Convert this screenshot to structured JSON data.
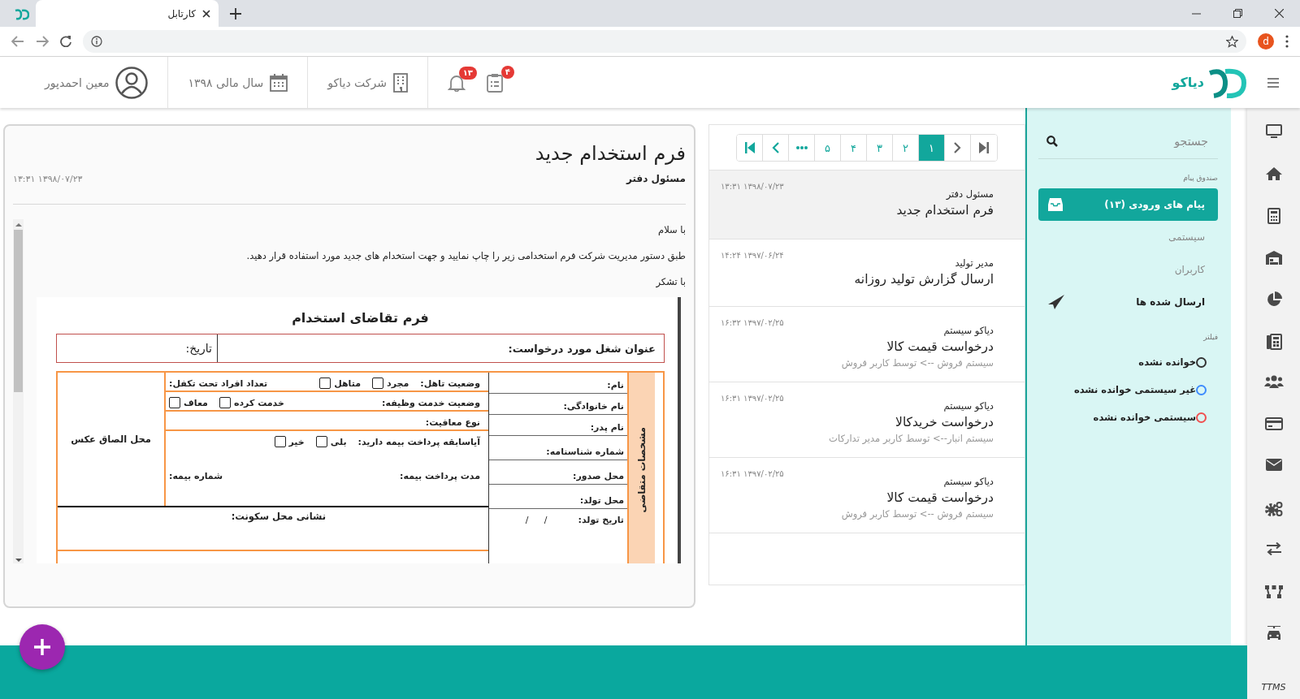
{
  "browser": {
    "tab_title": "کارتابل",
    "profile": "d"
  },
  "header": {
    "brand": "دیاکو",
    "user": "معین احمدپور",
    "fiscal_year": "سال مالی ۱۳۹۸",
    "company": "شرکت دیاکو",
    "notifications": "۱۳",
    "tasks": "۴"
  },
  "message": {
    "title": "فرم استخدام جدید",
    "sender": "مسئول دفتر",
    "time": "۱۳:۳۱ ۱۳۹۸/۰۷/۲۳",
    "paragraphs": [
      "با سلام",
      "طبق دستور مدیریت شرکت فرم استخدامی زیر را چاپ نمایید و جهت استخدام های جدید مورد استفاده قرار دهید.",
      "با تشکر"
    ],
    "document": {
      "title": "فرم تقاضای استخدام",
      "job_label": "عنوان شغل مورد درخواست:",
      "date_label": "تاریخ:",
      "section": "مشخصات متقاضی",
      "fields": [
        "نام:",
        "نام خانوادگی:",
        "نام پدر:",
        "شماره شناسنامه:",
        "محل صدور:",
        "محل تولد:",
        "تاریخ تولد:"
      ],
      "birth_date_marks": "/ /",
      "rows": [
        {
          "lines": [
            [
              {
                "kind": "label",
                "text": "وضعیت تاهل:"
              },
              {
                "kind": "option",
                "text": "مجرد",
                "checked": false
              },
              {
                "kind": "option",
                "text": "متاهل",
                "checked": false
              },
              {
                "kind": "gap"
              },
              {
                "kind": "label",
                "text": "تعداد افراد تحت تکفل:"
              }
            ]
          ]
        },
        {
          "lines": [
            [
              {
                "kind": "label",
                "text": "وضعیت خدمت وظیفه:"
              },
              {
                "kind": "gap"
              },
              {
                "kind": "option",
                "text": "خدمت کرده",
                "checked": false
              },
              {
                "kind": "option",
                "text": "معاف",
                "checked": false
              }
            ]
          ]
        },
        {
          "lines": [
            [
              {
                "kind": "label",
                "text": "نوع معافیت:"
              }
            ]
          ]
        },
        {
          "lines": [
            [
              {
                "kind": "label",
                "text": "آیاسابقه پرداخت بیمه دارید:"
              },
              {
                "kind": "option",
                "text": "بلی",
                "checked": false
              },
              {
                "kind": "option",
                "text": "خیر",
                "checked": false
              }
            ],
            [
              {
                "kind": "label",
                "text": "مدت پرداخت بیمه:"
              },
              {
                "kind": "gap"
              },
              {
                "kind": "label",
                "text": "شماره بیمه:"
              }
            ]
          ]
        }
      ],
      "photo": "محل الصاق عکس",
      "address": "نشانی محل سکونت:"
    }
  },
  "pagination": [
    {
      "kind": "last",
      "disabled": true
    },
    {
      "kind": "next",
      "disabled": true
    },
    {
      "kind": "page",
      "label": "۱",
      "selected": true
    },
    {
      "kind": "page",
      "label": "۲",
      "selected": false
    },
    {
      "kind": "page",
      "label": "۳",
      "selected": false
    },
    {
      "kind": "page",
      "label": "۴",
      "selected": false
    },
    {
      "kind": "page",
      "label": "۵",
      "selected": false
    },
    {
      "kind": "ellipsis",
      "disabled": false
    },
    {
      "kind": "prev",
      "disabled": false
    },
    {
      "kind": "first",
      "disabled": false
    }
  ],
  "messages": [
    {
      "sender": "مسئول دفتر",
      "subject": "فرم استخدام جدید",
      "time": "۱۳:۳۱ ۱۳۹۸/۰۷/۲۳",
      "selected": true
    },
    {
      "sender": "مدیر تولید",
      "subject": "ارسال گزارش تولید روزانه",
      "time": "۱۴:۲۴ ۱۳۹۷/۰۶/۲۴",
      "selected": false
    },
    {
      "sender": "دیاکو سیستم",
      "subject": "درخواست قیمت کالا",
      "detail": "سیستم فروش --> توسط کاربر فروش",
      "time": "۱۶:۳۲ ۱۳۹۷/۰۲/۲۵",
      "selected": false
    },
    {
      "sender": "دیاکو سیستم",
      "subject": "درخواست خریدکالا",
      "detail": "سیستم انبار--> توسط کاربر مدیر تدارکات",
      "time": "۱۶:۳۱ ۱۳۹۷/۰۲/۲۵",
      "selected": false
    },
    {
      "sender": "دیاکو سیستم",
      "subject": "درخواست قیمت کالا",
      "detail": "سیستم فروش --> توسط کاربر فروش",
      "time": "۱۶:۳۱ ۱۳۹۷/۰۲/۲۵",
      "selected": false
    }
  ],
  "sidebar": {
    "search": {
      "placeholder": "جستجو"
    },
    "section": "صندوق پیام",
    "items": [
      {
        "kind": "inbox",
        "label": "پیام های ورودی (۱۳)",
        "selected": true
      },
      {
        "kind": "subfolder",
        "label": "سیستمی",
        "selected": false
      },
      {
        "kind": "subfolder",
        "label": "کاربران",
        "selected": false
      },
      {
        "kind": "sent",
        "label": "ارسال شده ها",
        "selected": false
      }
    ],
    "filter_label": "فیلتر",
    "filters": [
      {
        "label": "خوانده نشده",
        "color": "#333333",
        "selected": false
      },
      {
        "label": "غیر سیستمی خوانده نشده",
        "color": "#3d8bfd",
        "selected": false
      },
      {
        "label": "سیستمی خوانده نشده",
        "color": "#f05050",
        "selected": false
      }
    ]
  },
  "rail": {
    "label": "TTMS"
  }
}
